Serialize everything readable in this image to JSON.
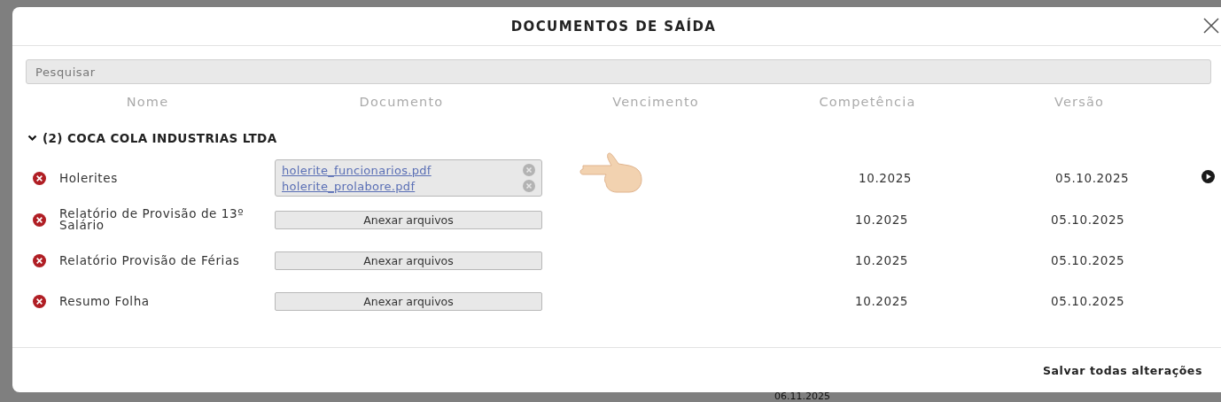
{
  "background": {
    "date": "06.11.2025"
  },
  "modal": {
    "title": "DOCUMENTOS DE SAÍDA",
    "search": {
      "placeholder": "Pesquisar"
    },
    "columns": [
      "Nome",
      "Documento",
      "Vencimento",
      "Competência",
      "Versão"
    ],
    "groups": [
      {
        "title": "(2) COCA COLA INDUSTRIAS LTDA",
        "expanded": true,
        "rows": [
          {
            "name": "Holerites",
            "kind": "files",
            "files": [
              "holerite_funcionarios.pdf",
              "holerite_prolabore.pdf"
            ],
            "competencia": "10.2025",
            "versao": "05.10.2025",
            "play": true,
            "pointer": true
          },
          {
            "name": "Relatório de Provisão de 13º Salário",
            "kind": "attach",
            "button": "Anexar arquivos",
            "competencia": "10.2025",
            "versao": "05.10.2025",
            "play": false,
            "pointer": false
          },
          {
            "name": "Relatório Provisão de Férias",
            "kind": "attach",
            "button": "Anexar arquivos",
            "competencia": "10.2025",
            "versao": "05.10.2025",
            "play": false,
            "pointer": false
          },
          {
            "name": "Resumo Folha",
            "kind": "attach",
            "button": "Anexar arquivos",
            "competencia": "10.2025",
            "versao": "05.10.2025",
            "play": false,
            "pointer": false
          }
        ]
      }
    ],
    "save_button": "Salvar todas alterações"
  }
}
